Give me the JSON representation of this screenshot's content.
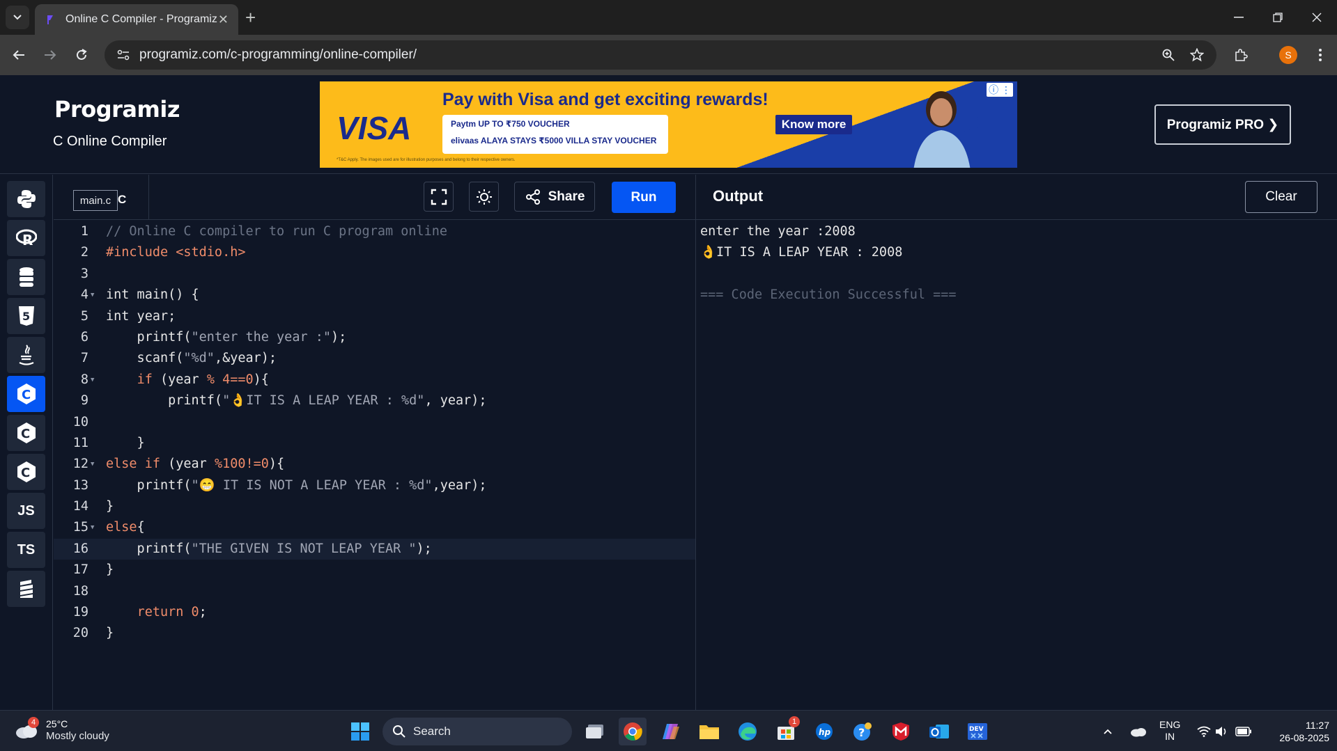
{
  "browser": {
    "tab_title": "Online C Compiler - Programiz",
    "url": "programiz.com/c-programming/online-compiler/",
    "profile_initial": "S"
  },
  "header": {
    "logo": "Programiz",
    "subtitle": "C Online Compiler",
    "pro_button": "Programiz PRO ❯"
  },
  "ad": {
    "brand": "VISA",
    "headline": "Pay with Visa and get exciting rewards!",
    "voucher_line1": "Paytm UP TO ₹750 VOUCHER",
    "voucher_line2": "elivaas ALAYA STAYS ₹5000 VILLA STAY VOUCHER",
    "cta": "Know more",
    "fine_print": "*T&C Apply. The images used are for illustration purposes and belong to their respective owners.",
    "info_icon": "ⓘ ⋮"
  },
  "sidebar": {
    "languages": [
      {
        "name": "python-icon",
        "label": ""
      },
      {
        "name": "r-icon",
        "label": "R"
      },
      {
        "name": "sql-icon",
        "label": ""
      },
      {
        "name": "html-icon",
        "label": "5"
      },
      {
        "name": "java-icon",
        "label": ""
      },
      {
        "name": "c-icon",
        "label": "C"
      },
      {
        "name": "cpp-icon",
        "label": "C"
      },
      {
        "name": "csharp-icon",
        "label": "C"
      },
      {
        "name": "js-icon",
        "label": "JS"
      },
      {
        "name": "ts-icon",
        "label": "TS"
      },
      {
        "name": "swift-icon",
        "label": ""
      }
    ]
  },
  "editor": {
    "file_name": "main.c",
    "file_suffix": "C",
    "share_label": "Share",
    "run_label": "Run",
    "lines": [
      "1",
      "2",
      "3",
      "4",
      "5",
      "6",
      "7",
      "8",
      "9",
      "10",
      "11",
      "12",
      "13",
      "14",
      "15",
      "16",
      "17",
      "18",
      "19",
      "20"
    ]
  },
  "output": {
    "title": "Output",
    "clear_label": "Clear",
    "lines": [
      "enter the year :2008",
      "👌IT IS A LEAP YEAR : 2008",
      "",
      "=== Code Execution Successful ==="
    ]
  },
  "taskbar": {
    "weather_badge": "4",
    "temperature": "25°C",
    "weather_desc": "Mostly cloudy",
    "search_label": "Search",
    "store_badge": "1",
    "lang_top": "ENG",
    "lang_bottom": "IN",
    "time": "11:27",
    "date": "26-08-2025"
  },
  "colors": {
    "accent": "#0556f3",
    "background": "#0f1626",
    "keyword": "#f08c6a",
    "comment": "#6b7486"
  }
}
